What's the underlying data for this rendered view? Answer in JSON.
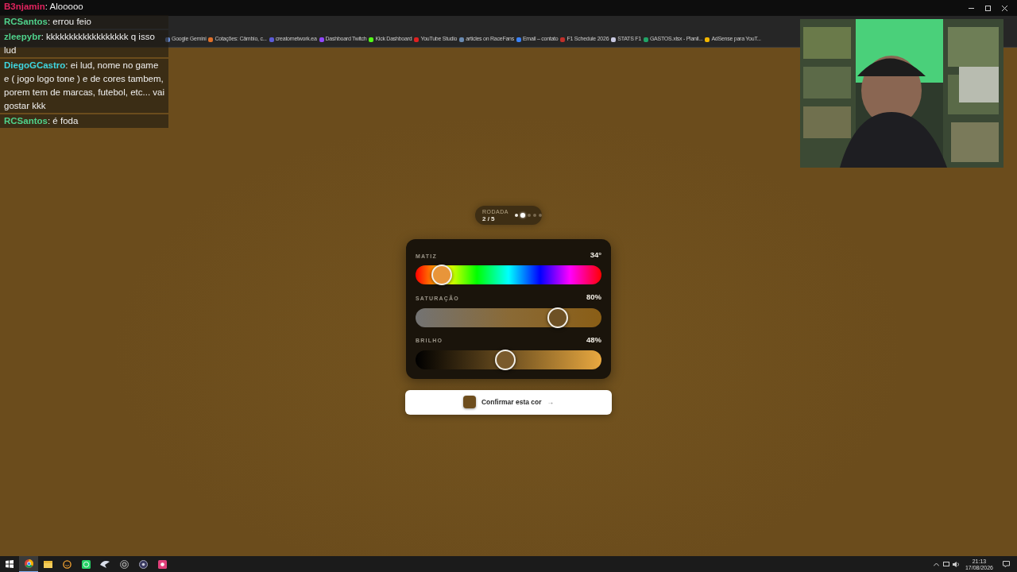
{
  "bookmarks": [
    {
      "label": "Google Gemini",
      "color": "#6b8fd6"
    },
    {
      "label": "Cotações: Câmbio, c...",
      "color": "#e0702a"
    },
    {
      "label": "creatornetwork.ea",
      "color": "#5b5bd6"
    },
    {
      "label": "Dashboard Twitch",
      "color": "#9147ff"
    },
    {
      "label": "Kick Dashboard",
      "color": "#53fc18"
    },
    {
      "label": "YouTube Studio",
      "color": "#e02020"
    },
    {
      "label": "articles on RaceFans",
      "color": "#6a8ab0"
    },
    {
      "label": "Email – contato",
      "color": "#3b82f6"
    },
    {
      "label": "F1 Schedule 2026",
      "color": "#c0302a"
    },
    {
      "label": "STATS F1",
      "color": "#c8c8e0"
    },
    {
      "label": "GASTOS.xlsx - Planil...",
      "color": "#21a366"
    },
    {
      "label": "AdSense para YouT...",
      "color": "#f2b600"
    }
  ],
  "chat": [
    {
      "kind": "plain",
      "user": "B3njamin",
      "separator": ":",
      "text": "Alooooo",
      "color": "#e0245e"
    },
    {
      "kind": "boxed",
      "user": "RCSantos",
      "separator": ":",
      "text": "errou feio",
      "color": "#4fd18b"
    },
    {
      "kind": "boxed",
      "user": "zleepybr",
      "separator": ":",
      "text": "kkkkkkkkkkkkkkkkkk q isso lud",
      "color": "#4fd18b"
    },
    {
      "kind": "boxed",
      "user": "DiegoGCastro",
      "separator": ":",
      "text": "ei lud, nome no game e ( jogo logo tone ) e de cores tambem, porem tem de marcas, futebol, etc... vai gostar kkk",
      "color": "#3fd6e0"
    },
    {
      "kind": "boxed",
      "user": "RCSantos",
      "separator": ":",
      "text": "é foda",
      "color": "#4fd18b"
    }
  ],
  "round": {
    "label": "RODADA",
    "value": "2 / 5",
    "dots": [
      {
        "kind": "done"
      },
      {
        "kind": "current"
      },
      {
        "kind": "pending"
      },
      {
        "kind": "pending"
      },
      {
        "kind": "pending"
      }
    ]
  },
  "sliders": [
    {
      "kind": "hue",
      "label": "MATIZ",
      "reading": "34°",
      "level": 0.094
    },
    {
      "kind": "saturation",
      "label": "SATURAÇÃO",
      "reading": "80%",
      "level": 0.8
    },
    {
      "kind": "brightness",
      "label": "BRILHO",
      "reading": "48%",
      "level": 0.48
    }
  ],
  "confirm": {
    "label": "Confirmar esta cor",
    "arrow": "→",
    "color": "#6e4e1e"
  },
  "taskbar": [
    {
      "kind": "start",
      "selected": false
    },
    {
      "kind": "chrome",
      "selected": true
    },
    {
      "kind": "folder",
      "selected": false
    },
    {
      "kind": "chat",
      "selected": false
    },
    {
      "kind": "whatsapp",
      "selected": false
    },
    {
      "kind": "bird",
      "selected": false
    },
    {
      "kind": "obs",
      "selected": false
    },
    {
      "kind": "fourk",
      "selected": false
    },
    {
      "kind": "pink",
      "selected": false
    }
  ],
  "tray": {
    "time": "21:13",
    "date": "17/08/2026"
  }
}
